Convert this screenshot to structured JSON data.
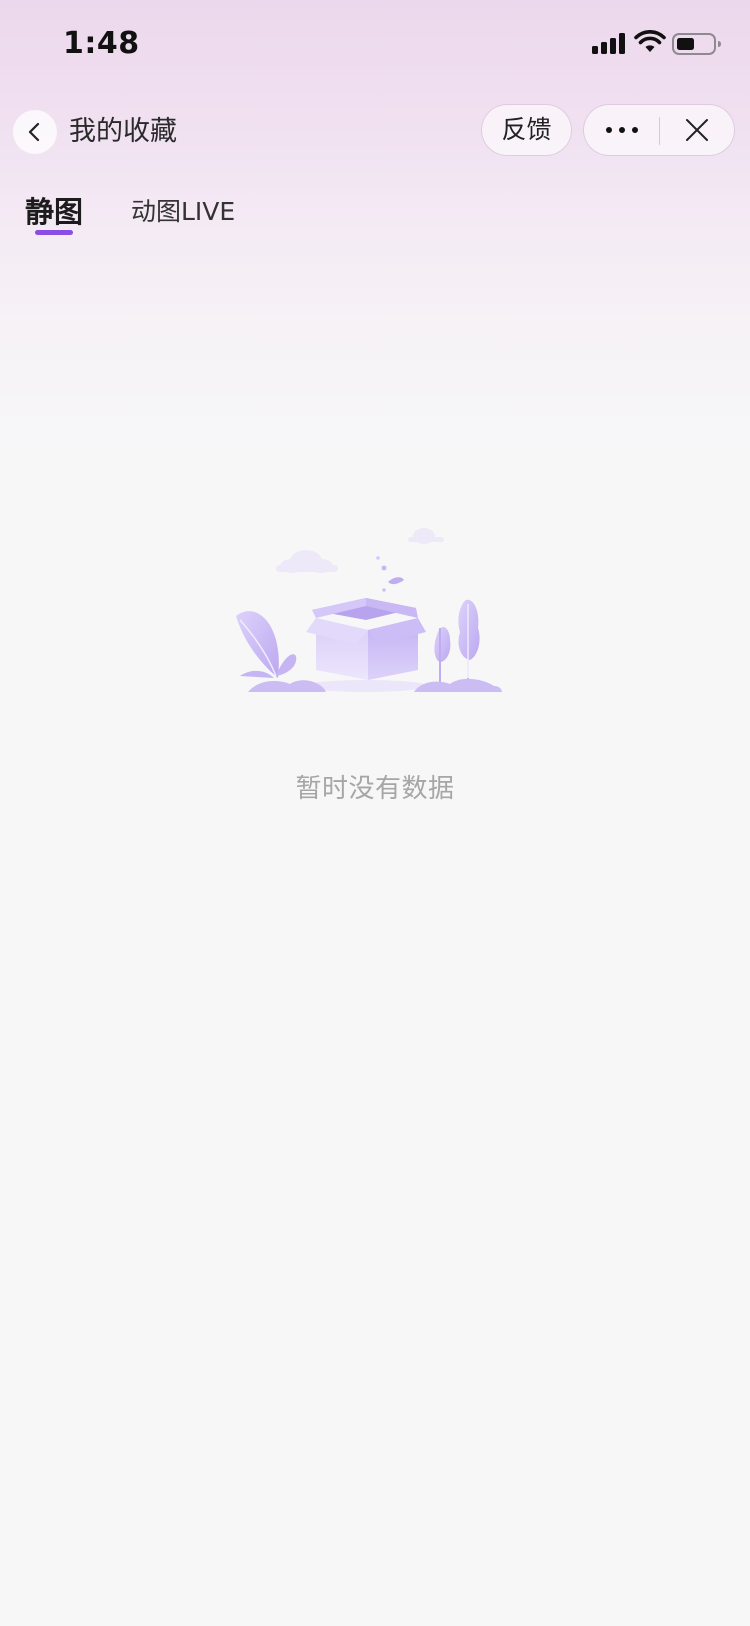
{
  "status_bar": {
    "time": "1:48"
  },
  "nav": {
    "title": "我的收藏",
    "feedback_label": "反馈"
  },
  "tabs": [
    {
      "label": "静图",
      "active": true
    },
    {
      "label": "动图LIVE",
      "active": false
    }
  ],
  "empty_state": {
    "message": "暂时没有数据"
  },
  "colors": {
    "accent": "#8a4de6",
    "illustration": "#c9b8f2"
  }
}
